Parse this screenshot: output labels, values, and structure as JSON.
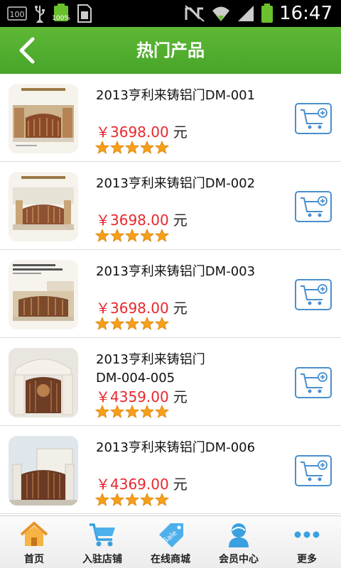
{
  "status_bar": {
    "time": "16:47",
    "battery_percent": "100%",
    "notification_badge": "100"
  },
  "header": {
    "title": "热门产品"
  },
  "products": [
    {
      "name": "2013亨利来铸铝门DM-001",
      "price": "￥3698.00",
      "unit": "元",
      "rating": 5
    },
    {
      "name": "2013亨利来铸铝门DM-002",
      "price": "￥3698.00",
      "unit": "元",
      "rating": 5
    },
    {
      "name": "2013亨利来铸铝门DM-003",
      "price": "￥3698.00",
      "unit": "元",
      "rating": 5
    },
    {
      "name": "2013亨利来铸铝门DM-004-005",
      "price": "￥4359.00",
      "unit": "元",
      "rating": 5
    },
    {
      "name": "2013亨利来铸铝门DM-006",
      "price": "￥4369.00",
      "unit": "元",
      "rating": 5
    }
  ],
  "tabs": [
    {
      "label": "首页",
      "icon": "home-icon"
    },
    {
      "label": "入驻店铺",
      "icon": "cart-icon"
    },
    {
      "label": "在线商城",
      "icon": "sale-tag-icon"
    },
    {
      "label": "会员中心",
      "icon": "member-icon"
    },
    {
      "label": "更多",
      "icon": "more-icon"
    }
  ],
  "colors": {
    "header_green": "#4fab2e",
    "price_red": "#e8272d",
    "cart_blue": "#4a8fcb",
    "star_orange": "#f5a01a"
  }
}
